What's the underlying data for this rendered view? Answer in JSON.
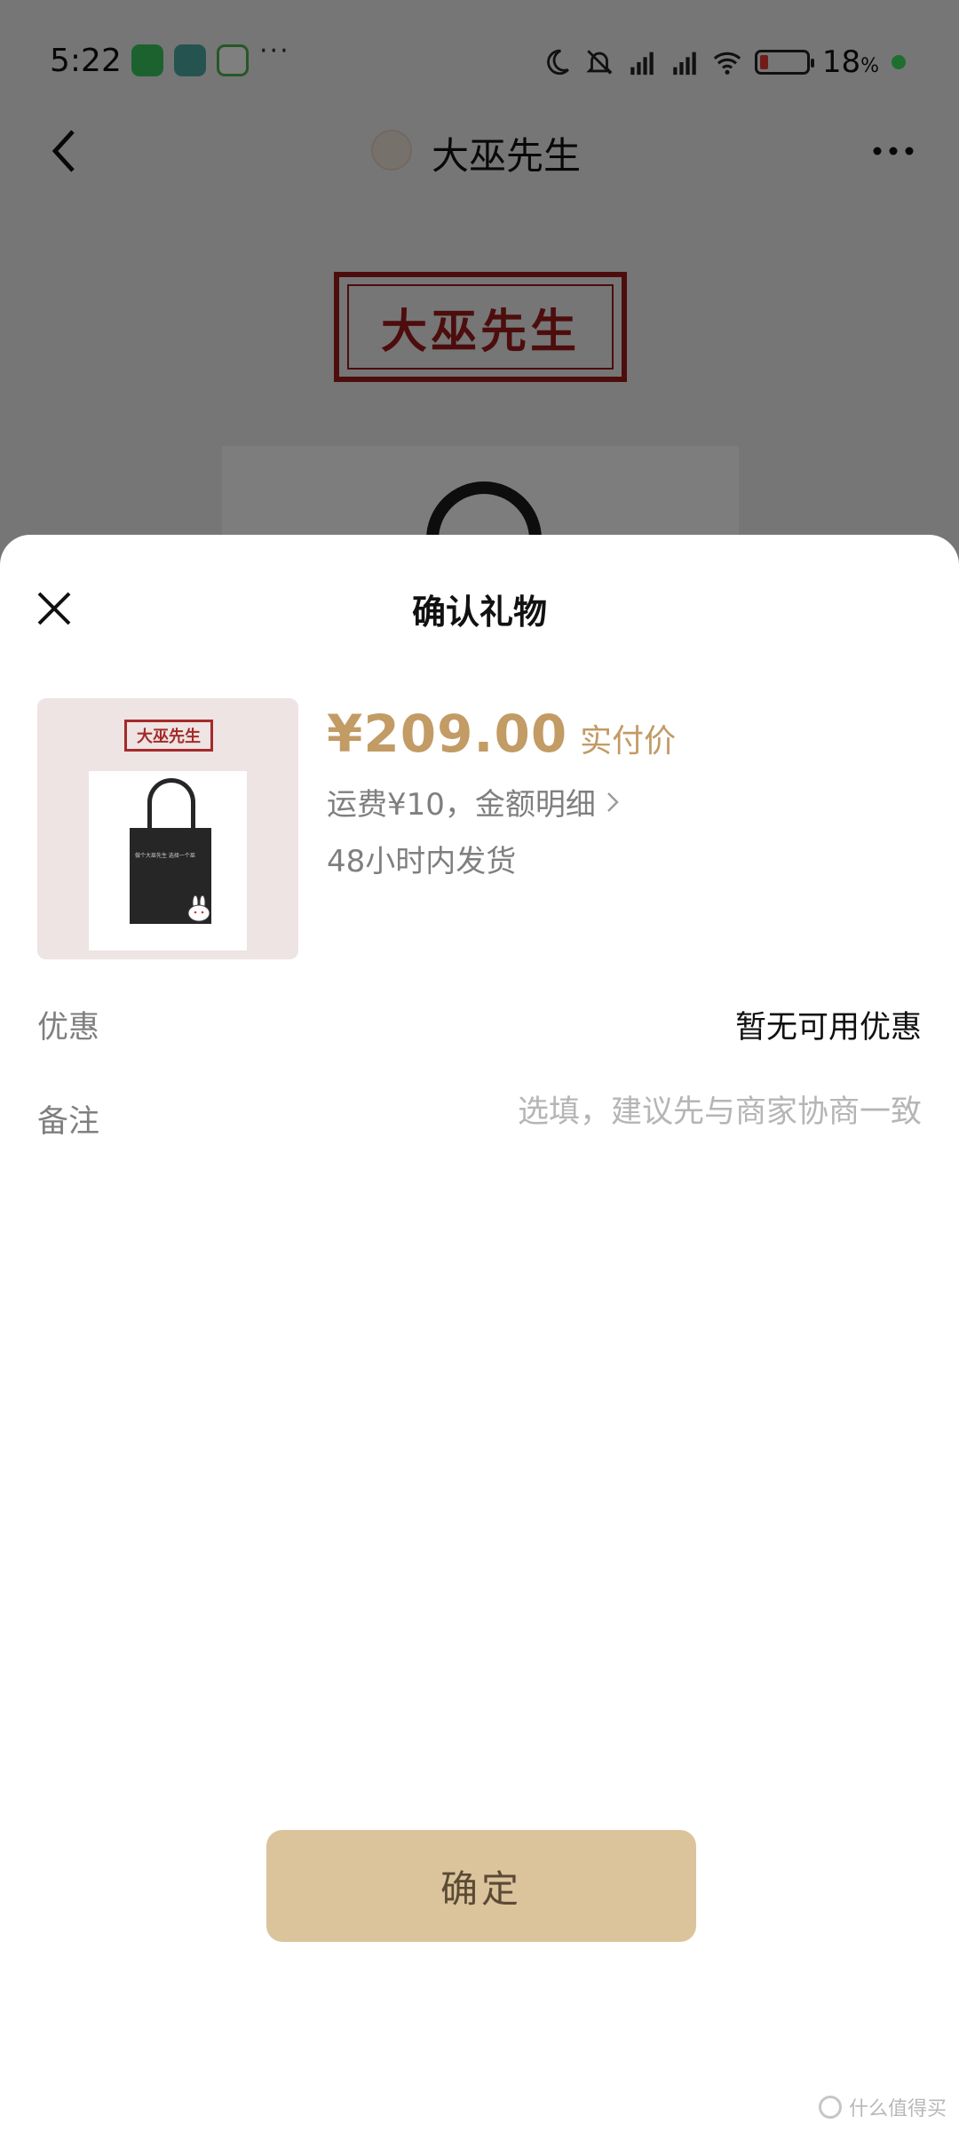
{
  "status_bar": {
    "time": "5:22",
    "battery_percent": "18",
    "battery_unit": "%",
    "battery_level": 0.18,
    "icons": [
      "wechat-app-icon",
      "teal-app-icon",
      "green-app-icon",
      "more-dots-icon",
      "moon-icon",
      "bell-muted-icon",
      "signal-hd-icon",
      "signal-hd-icon",
      "wifi-icon",
      "battery-icon",
      "charging-dot-icon"
    ]
  },
  "nav": {
    "title": "大巫先生",
    "back_icon": "chevron-left-icon",
    "more_icon": "more-dots-icon"
  },
  "background": {
    "logo_text": "大巫先生"
  },
  "sheet": {
    "title": "确认礼物",
    "close_icon": "close-icon",
    "product": {
      "thumb_logo": "大巫先生",
      "bag_text": "做个大巫先生 选择一个巫",
      "price": "¥209.00",
      "price_label": "实付价",
      "shipping": "运费¥10，金额明细",
      "delivery": "48小时内发货"
    },
    "discount": {
      "label": "优惠",
      "value": "暂无可用优惠"
    },
    "remark": {
      "label": "备注",
      "placeholder": "选填，建议先与商家协商一致",
      "value": ""
    },
    "confirm_label": "确定"
  },
  "watermark": {
    "text": "什么值得买"
  },
  "colors": {
    "accent_gold": "#c29b65",
    "button_bg": "#dbc49c",
    "brand_red": "#9b1b1b",
    "battery_low": "#e53935",
    "charge_green": "#3ddc5c"
  }
}
